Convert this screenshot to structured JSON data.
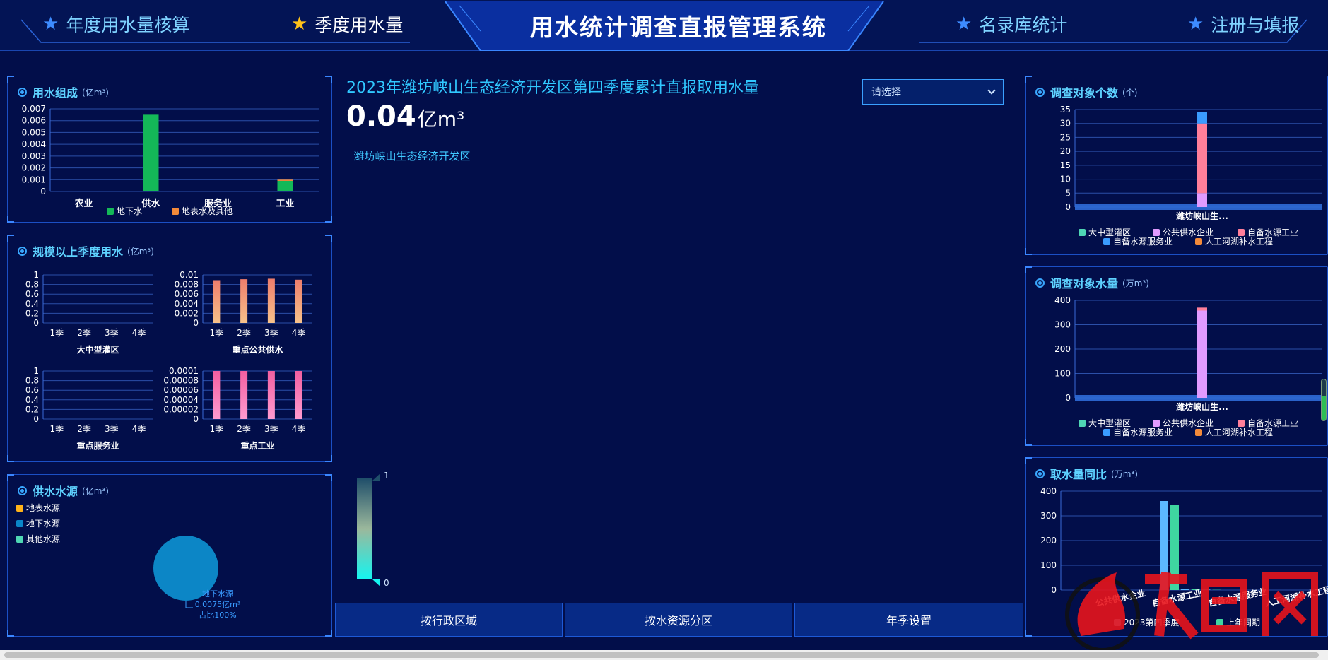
{
  "header": {
    "title": "用水统计调查直报管理系统",
    "nav": [
      {
        "label": "年度用水量核算",
        "icon": "star-icon"
      },
      {
        "label": "季度用水量",
        "icon": "star-icon",
        "active": true
      },
      {
        "label": "名录库统计",
        "icon": "star-icon"
      },
      {
        "label": "注册与填报",
        "icon": "star-icon"
      }
    ]
  },
  "colors": {
    "accent": "#30c8ff",
    "green": "#14b858",
    "orange": "#f38a3a",
    "pink": "#ff7f9a",
    "violet": "#e19bff",
    "blue": "#3a9cff",
    "teal": "#4fd6b4",
    "gold": "#ffb31a"
  },
  "panels": {
    "composition": {
      "title": "用水组成",
      "unit": "(亿m³)"
    },
    "quarterly": {
      "title": "规模以上季度用水",
      "unit": "(亿m³)"
    },
    "source": {
      "title": "供水水源",
      "unit": "(亿m³)"
    },
    "survey_count": {
      "title": "调查对象个数",
      "unit": "(个)"
    },
    "survey_water": {
      "title": "调查对象水量",
      "unit": "(万m³)"
    },
    "yoy": {
      "title": "取水量同比",
      "unit": "(万m³)"
    }
  },
  "center": {
    "headline": "2023年潍坊峡山生态经济开发区第四季度累计直报取用水量",
    "value": "0.04",
    "unit": "亿m³",
    "region": "潍坊峡山生态经济开发区",
    "select_placeholder": "请选择",
    "legend_max": "1",
    "legend_min": "0"
  },
  "buttons": [
    "按行政区域",
    "按水资源分区",
    "年季设置"
  ],
  "chart_data": [
    {
      "id": "composition",
      "type": "bar",
      "categories": [
        "农业",
        "供水",
        "服务业",
        "工业"
      ],
      "series": [
        {
          "name": "地下水",
          "values": [
            0,
            0.0065,
            5e-05,
            0.0009
          ]
        },
        {
          "name": "地表水及其他",
          "values": [
            0,
            0,
            0,
            0.0001
          ]
        }
      ],
      "ylim": [
        0,
        0.007
      ],
      "ticks": [
        "0",
        "0.001",
        "0.002",
        "0.003",
        "0.004",
        "0.005",
        "0.006",
        "0.007"
      ]
    },
    {
      "id": "q_irrigation",
      "type": "bar",
      "title": "大中型灌区",
      "categories": [
        "1季",
        "2季",
        "3季",
        "4季"
      ],
      "values": [
        0,
        0,
        0,
        0
      ],
      "ylim": [
        0,
        1
      ],
      "ticks": [
        "0",
        "0.2",
        "0.4",
        "0.6",
        "0.8",
        "1"
      ]
    },
    {
      "id": "q_public",
      "type": "bar",
      "title": "重点公共供水",
      "categories": [
        "1季",
        "2季",
        "3季",
        "4季"
      ],
      "values": [
        0.0089,
        0.0091,
        0.0092,
        0.009
      ],
      "ylim": [
        0,
        0.01
      ],
      "ticks": [
        "0",
        "0.002",
        "0.004",
        "0.006",
        "0.008",
        "0.01"
      ]
    },
    {
      "id": "q_service",
      "type": "bar",
      "title": "重点服务业",
      "categories": [
        "1季",
        "2季",
        "3季",
        "4季"
      ],
      "values": [
        0,
        0,
        0,
        0
      ],
      "ylim": [
        0,
        1
      ],
      "ticks": [
        "0",
        "0.2",
        "0.4",
        "0.6",
        "0.8",
        "1"
      ]
    },
    {
      "id": "q_industry",
      "type": "bar",
      "title": "重点工业",
      "categories": [
        "1季",
        "2季",
        "3季",
        "4季"
      ],
      "values": [
        0.0001,
        0.0001,
        0.0001,
        0.0001
      ],
      "ylim": [
        0,
        0.0001
      ],
      "ticks": [
        "0",
        "0.00002",
        "0.00004",
        "0.00006",
        "0.00008",
        "0.0001"
      ]
    },
    {
      "id": "source",
      "type": "pie",
      "legend": [
        "地表水源",
        "地下水源",
        "其他水源"
      ],
      "slices": [
        {
          "name": "地下水源",
          "value": 0.0075,
          "share": "100%"
        }
      ],
      "label_lines": [
        "地下水源",
        "0.0075亿m³",
        "占比100%"
      ]
    },
    {
      "id": "survey_count",
      "type": "bar",
      "stacked": true,
      "categories": [
        "潍坊峡山生..."
      ],
      "series": [
        {
          "name": "大中型灌区",
          "values": [
            0
          ]
        },
        {
          "name": "公共供水企业",
          "values": [
            5
          ]
        },
        {
          "name": "自备水源工业",
          "values": [
            25
          ]
        },
        {
          "name": "自备水源服务业",
          "values": [
            4
          ]
        },
        {
          "name": "人工河湖补水工程",
          "values": [
            0
          ]
        }
      ],
      "ylim": [
        0,
        35
      ],
      "ticks": [
        "0",
        "5",
        "10",
        "15",
        "20",
        "25",
        "30",
        "35"
      ]
    },
    {
      "id": "survey_water",
      "type": "bar",
      "stacked": true,
      "categories": [
        "潍坊峡山生..."
      ],
      "series": [
        {
          "name": "大中型灌区",
          "values": [
            0
          ]
        },
        {
          "name": "公共供水企业",
          "values": [
            358
          ]
        },
        {
          "name": "自备水源工业",
          "values": [
            12
          ]
        },
        {
          "name": "自备水源服务业",
          "values": [
            0
          ]
        },
        {
          "name": "人工河湖补水工程",
          "values": [
            0
          ]
        }
      ],
      "ylim": [
        0,
        400
      ],
      "ticks": [
        "0",
        "100",
        "200",
        "300",
        "400"
      ]
    },
    {
      "id": "yoy",
      "type": "bar",
      "categories": [
        "公共供水企业",
        "自备水源工业",
        "自备水源服务业",
        "人工河湖补水工程"
      ],
      "series": [
        {
          "name": "2023第四季度",
          "values": [
            360,
            3,
            2,
            0
          ]
        },
        {
          "name": "上年同期",
          "values": [
            345,
            4,
            1,
            0
          ]
        }
      ],
      "ylim": [
        0,
        400
      ],
      "ticks": [
        "0",
        "100",
        "200",
        "300",
        "400"
      ]
    }
  ]
}
